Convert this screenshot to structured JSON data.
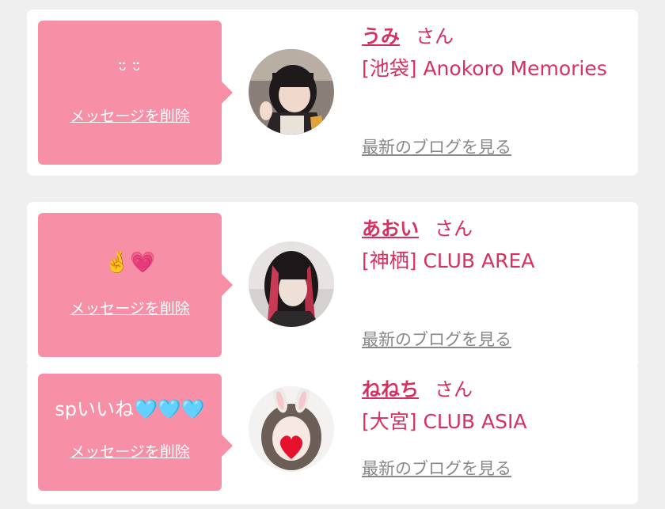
{
  "colors": {
    "background": "#efefef",
    "card": "#ffffff",
    "bubble": "#f78fa7",
    "accent": "#d8305e",
    "link_gray": "#888888"
  },
  "cards": [
    {
      "message": "ᵕ̈ ᵕ̈",
      "delete_label": "メッセージを削除",
      "name": "うみ",
      "honorific": "さん",
      "shop": "[池袋] Anokoro Memories",
      "blog_label": "最新のブログを見る"
    },
    {
      "message": "🤞💗",
      "delete_label": "メッセージを削除",
      "name": "あおい",
      "honorific": "さん",
      "shop": "[神栖] CLUB AREA",
      "blog_label": "最新のブログを見る"
    },
    {
      "message": "spいいね🩵🩵🩵",
      "delete_label": "メッセージを削除",
      "name": "ねねち",
      "honorific": "さん",
      "shop": "[大宮] CLUB ASIA",
      "blog_label": "最新のブログを見る"
    }
  ]
}
